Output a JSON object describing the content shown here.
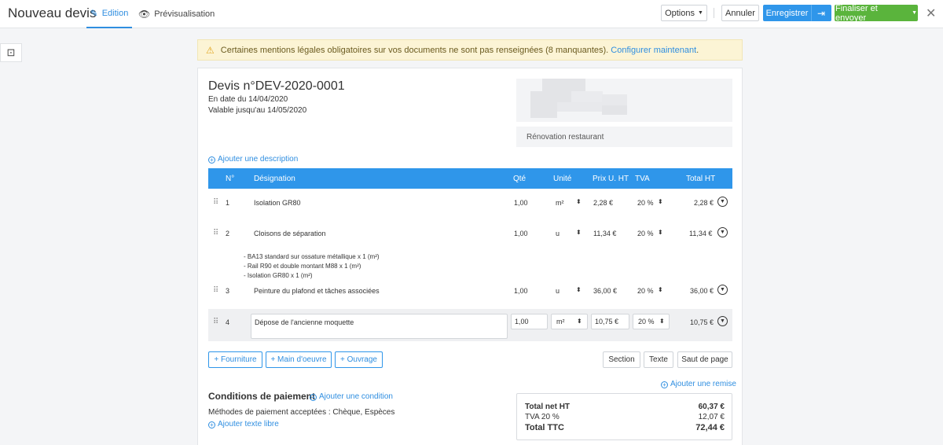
{
  "header": {
    "title": "Nouveau devis",
    "tabs": {
      "edit": "Edition",
      "preview": "Prévisualisation"
    },
    "buttons": {
      "options": "Options",
      "cancel": "Annuler",
      "save": "Enregistrer",
      "finalize": "Finaliser et envoyer"
    },
    "icons": {
      "edit": "pencil-icon",
      "preview": "eye-icon",
      "save_exit": "exit-icon",
      "close": "close-icon",
      "side": "box-icon"
    }
  },
  "warning": {
    "text": "Certaines mentions légales obligatoires sur vos documents ne sont pas renseignées (8 manquantes).",
    "link": "Configurer maintenant",
    "end": "."
  },
  "doc": {
    "title": "Devis n°DEV-2020-0001",
    "date_line": "En date du 14/04/2020",
    "valid_line": "Valable jusqu'au 14/05/2020",
    "project": "Rénovation restaurant",
    "add_description": "Ajouter une description"
  },
  "table": {
    "headers": {
      "num": "N°",
      "designation": "Désignation",
      "qty": "Qté",
      "unit": "Unité",
      "price": "Prix U. HT",
      "vat": "TVA",
      "total": "Total HT"
    },
    "rows": [
      {
        "num": "1",
        "designation": "Isolation GR80",
        "qty": "1,00",
        "unit": "m²",
        "price": "2,28 €",
        "vat": "20 %",
        "total": "2,28 €"
      },
      {
        "num": "2",
        "designation": "Cloisons de séparation",
        "qty": "1,00",
        "unit": "u",
        "price": "11,34 €",
        "vat": "20 %",
        "total": "11,34 €",
        "details": [
          "- BA13 standard sur ossature métallique x 1 (m²)",
          "- Rail R90 et double montant M88 x 1 (m²)",
          "- Isolation GR80 x 1 (m²)"
        ]
      },
      {
        "num": "3",
        "designation": "Peinture du plafond et tâches associées",
        "qty": "1,00",
        "unit": "u",
        "price": "36,00 €",
        "vat": "20 %",
        "total": "36,00 €"
      },
      {
        "num": "4",
        "designation": "Dépose de l'ancienne moquette",
        "qty": "1,00",
        "unit": "m²",
        "price": "10,75 €",
        "vat": "20 %",
        "total": "10,75 €"
      }
    ]
  },
  "actions": {
    "supply": "+ Fourniture",
    "labor": "+ Main d'oeuvre",
    "work": "+ Ouvrage",
    "section": "Section",
    "text": "Texte",
    "page_break": "Saut de page"
  },
  "payment": {
    "title": "Conditions de paiement",
    "add_condition": "Ajouter une condition",
    "methods": "Méthodes de paiement acceptées : Chèque, Espèces",
    "add_free_text": "Ajouter texte libre",
    "add_discount": "Ajouter une remise"
  },
  "totals": {
    "net_label": "Total net HT",
    "net_value": "60,37 €",
    "vat_label": "TVA 20 %",
    "vat_value": "12,07 €",
    "ttc_label": "Total TTC",
    "ttc_value": "72,44 €"
  }
}
